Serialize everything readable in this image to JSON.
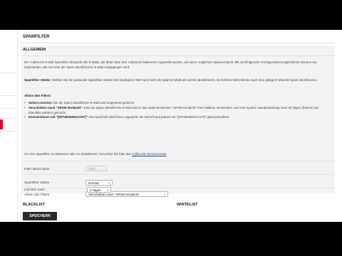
{
  "page": {
    "title": "SPAMFILTER",
    "section_title": "ALLGEMEIN"
  },
  "texts": {
    "intro": "Der CableLink E-Mail Spamfilter überprüft alle E-Mails, die Ihnen über den CableLink Mailserver zugestellt werden, auf einen möglichen Spamverdacht. Mit nachfolgenden Konfigurationsmöglichkeiten können Sie entscheiden, wie mit einer als Spam identifizierten E-Mail vorgegangen wird:",
    "staerke_label": "Spamfilter Stärke:",
    "staerke_text": "Wählen Sie die passende Spamfilter Stärke! Ein niedrigerer Wert wird mehr als Spam E-Mails als solche identifizieren, ein höherer Wert könnte auch eine gültige E-Mail als Spam identifizieren.",
    "aktion_head": "Aktion des Filters",
    "bullets": [
      {
        "label": "Sofort Löschen:",
        "text": "Die als Spam identifizierte E-Mail wird umgehend gelöscht."
      },
      {
        "label": "Verschieben nach \"SPAM-Verdacht\":",
        "text": "Eine als Spam identifizierte E-Mail wird in das Unterverzeichnis \"SPAM-Verdacht\" Ihrer Mailbox verschoben und vom System standardmässig nach 30 Tagen (können Sie ebenfalls wählen) gelöscht."
      },
      {
        "label": "Kennzeichnen mit \"[SPAMVERDACHT]\":",
        "text": "Die Nachricht wird Ihnen zugestellt, der Betreff wird jedoch mit \"[SPAMVERDACHT]\" gekennzeichnet."
      }
    ],
    "hint_before": "Um den Spamfilter zu aktivieren oder zu deaktivieren, besuchen Sie bitte das",
    "hint_link": "CableLink-ServiceCenter",
    "hint_after": "."
  },
  "form": {
    "filter_label": "Filter aktiv/inaktiv",
    "filter_value": "Aktiv",
    "staerke_label": "Spamfilter Stärke",
    "staerke_value": "Normal",
    "aktion_label": "Aktion des Filters",
    "aktion_value": "Verschieben nach \"SPAM-Verdacht\"",
    "loeschen_label": "Löschen nach",
    "loeschen_value": "3 Tagen"
  },
  "bottom": {
    "blacklist": "BLACKLIST",
    "whitelist": "WHITELIST",
    "save": "SPEICHERN"
  },
  "colors": {
    "accent": "#c8102e",
    "button": "#2b2b2b",
    "panel": "#f3f3f3"
  }
}
